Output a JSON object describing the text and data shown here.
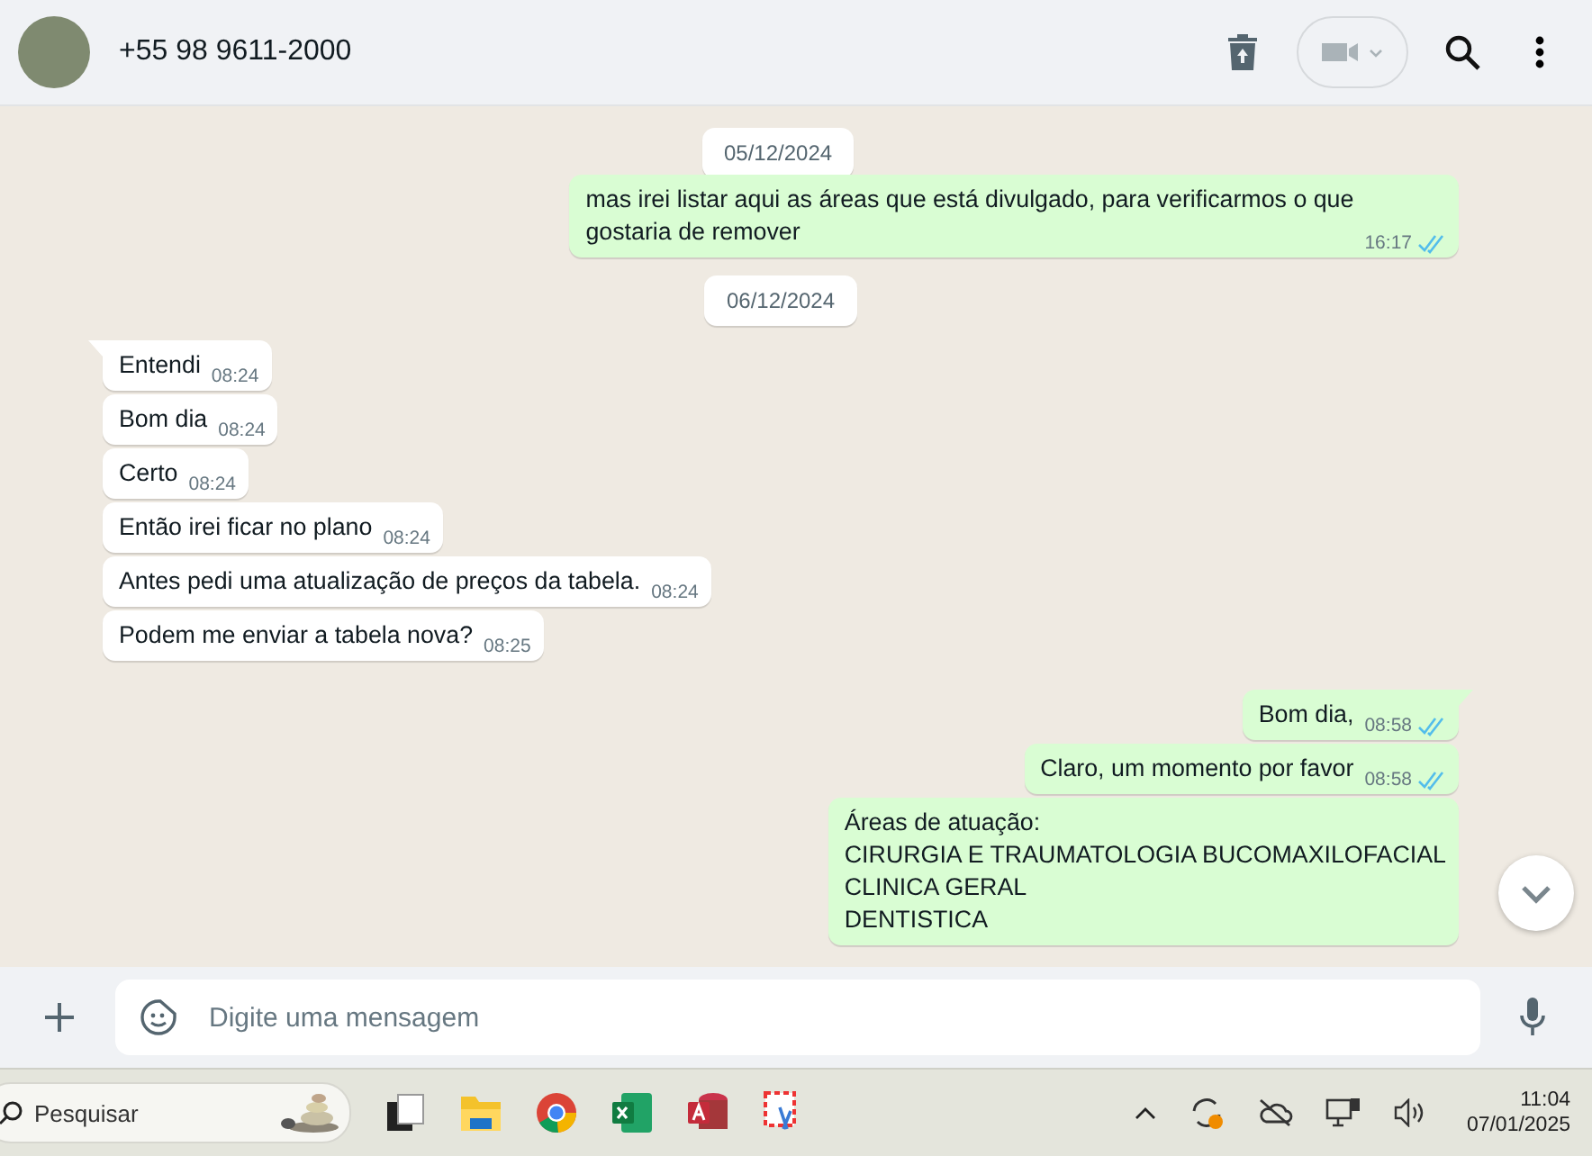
{
  "header": {
    "contact": "+55 98 9611-2000"
  },
  "sticky_date": "05/12/2024",
  "messages": [
    {
      "kind": "message",
      "outgoing": true,
      "lines": [
        "mas irei listar aqui as áreas que está divulgado, para verificarmos o que",
        "gostaria de remover"
      ],
      "time": "16:17",
      "read": true,
      "tail": false
    },
    {
      "kind": "date",
      "text": "06/12/2024"
    },
    {
      "kind": "message",
      "outgoing": false,
      "lines": [
        "Entendi"
      ],
      "time": "08:24",
      "tail": true
    },
    {
      "kind": "message",
      "outgoing": false,
      "lines": [
        "Bom dia"
      ],
      "time": "08:24",
      "tail": false
    },
    {
      "kind": "message",
      "outgoing": false,
      "lines": [
        "Certo"
      ],
      "time": "08:24",
      "tail": false
    },
    {
      "kind": "message",
      "outgoing": false,
      "lines": [
        "Então irei ficar no plano"
      ],
      "time": "08:24",
      "tail": false
    },
    {
      "kind": "message",
      "outgoing": false,
      "lines": [
        "Antes pedi uma atualização de preços da tabela."
      ],
      "time": "08:24",
      "tail": false
    },
    {
      "kind": "message",
      "outgoing": false,
      "lines": [
        "Podem me enviar a tabela nova?"
      ],
      "time": "08:25",
      "tail": false
    },
    {
      "kind": "message",
      "outgoing": true,
      "lines": [
        "Bom dia,"
      ],
      "time": "08:58",
      "read": true,
      "tail": true
    },
    {
      "kind": "message",
      "outgoing": true,
      "lines": [
        "Claro, um momento por favor"
      ],
      "time": "08:58",
      "read": true,
      "tail": false
    },
    {
      "kind": "message",
      "outgoing": true,
      "lines": [
        "Áreas de atuação:",
        "CIRURGIA E TRAUMATOLOGIA BUCOMAXILOFACIAL",
        "CLINICA GERAL",
        "DENTISTICA"
      ],
      "tail": false
    }
  ],
  "composer": {
    "placeholder": "Digite uma mensagem"
  },
  "taskbar": {
    "search_placeholder": "Pesquisar",
    "time": "11:04",
    "date": "07/01/2025"
  }
}
